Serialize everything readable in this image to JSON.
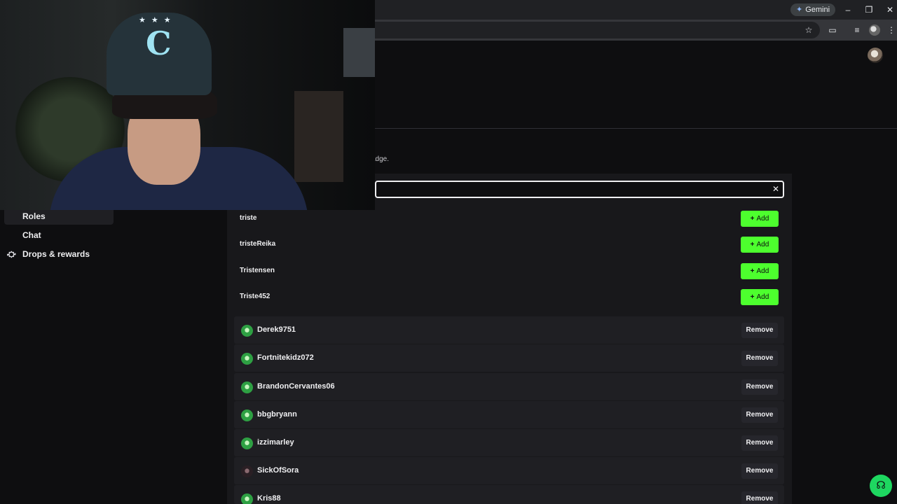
{
  "browser": {
    "gemini_label": "Gemini",
    "minimize": "–",
    "restore": "❐",
    "close": "✕",
    "toolbar_icons": [
      "star-icon",
      "cast-icon",
      "tab-search-icon",
      "profile-icon",
      "menu-icon"
    ]
  },
  "page": {
    "description_fragment": "adge."
  },
  "sidebar": {
    "items": [
      {
        "label": "Roles",
        "icon": "",
        "active": true
      },
      {
        "label": "Chat",
        "icon": "",
        "active": false
      },
      {
        "label": "Drops & rewards",
        "icon": "gift-icon",
        "active": false
      }
    ]
  },
  "search": {
    "value": "",
    "clear_label": "✕"
  },
  "search_results": [
    {
      "name": "triste",
      "button": "Add"
    },
    {
      "name": "tristeReika",
      "button": "Add"
    },
    {
      "name": "Tristensen",
      "button": "Add"
    },
    {
      "name": "Triste452",
      "button": "Add"
    }
  ],
  "vips": [
    {
      "name": "Derek9751",
      "button": "Remove"
    },
    {
      "name": "Fortnitekidz072",
      "button": "Remove"
    },
    {
      "name": "BrandonCervantes06",
      "button": "Remove"
    },
    {
      "name": "bbgbryann",
      "button": "Remove"
    },
    {
      "name": "izzimarley",
      "button": "Remove"
    },
    {
      "name": "SickOfSora",
      "button": "Remove"
    },
    {
      "name": "Kris88",
      "button": "Remove"
    }
  ],
  "colors": {
    "add_button": "#4dff2e",
    "background": "#0e0e10",
    "panel": "#18181b",
    "row": "#1f1f23",
    "help_button": "#1ed760"
  }
}
